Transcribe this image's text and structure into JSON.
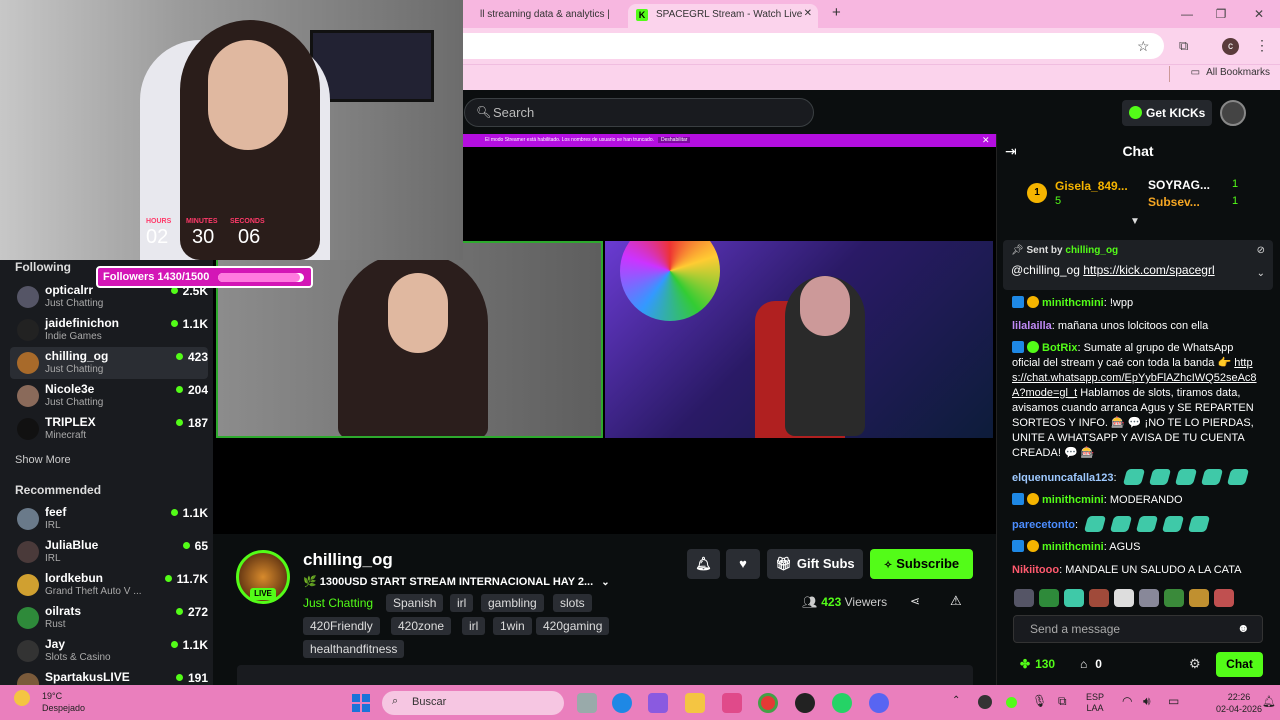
{
  "browser": {
    "tabs": [
      {
        "title": "ll streaming data & analytics |"
      },
      {
        "title": "SPACEGRL Stream - Watch Live"
      }
    ],
    "new_tab": "+",
    "profile_initial": "c",
    "bookmarks_label": "All Bookmarks"
  },
  "kick_header": {
    "search_placeholder": "Search",
    "get_kicks": "Get KICKs"
  },
  "overlay": {
    "timer_labels": [
      "HOURS",
      "MINUTES",
      "SECONDS"
    ],
    "timer_values": [
      "02",
      "30",
      "06"
    ],
    "followers_text": "Followers 1430/1500",
    "followers_progress": 0.953
  },
  "notice": {
    "text": "El modo Streamer está habilitado. Los nombres de usuario se han truncado.",
    "button": "Deshabilitar"
  },
  "sidebar": {
    "following_label": "Following",
    "following": [
      {
        "name": "opticalrr",
        "category": "Just Chatting",
        "viewers": "2.5K"
      },
      {
        "name": "jaidefinichon",
        "category": "Indie Games",
        "viewers": "1.1K"
      },
      {
        "name": "chilling_og",
        "category": "Just Chatting",
        "viewers": "423"
      },
      {
        "name": "Nicole3e",
        "category": "Just Chatting",
        "viewers": "204"
      },
      {
        "name": "TRIPLEX",
        "category": "Minecraft",
        "viewers": "187"
      }
    ],
    "show_more": "Show More",
    "recommended_label": "Recommended",
    "recommended": [
      {
        "name": "feef",
        "category": "IRL",
        "viewers": "1.1K"
      },
      {
        "name": "JuliaBlue",
        "category": "IRL",
        "viewers": "65"
      },
      {
        "name": "lordkebun",
        "category": "Grand Theft Auto V ...",
        "viewers": "11.7K"
      },
      {
        "name": "oilrats",
        "category": "Rust",
        "viewers": "272"
      },
      {
        "name": "Jay",
        "category": "Slots & Casino",
        "viewers": "1.1K"
      },
      {
        "name": "SpartakusLIVE",
        "category": "",
        "viewers": "191"
      }
    ]
  },
  "stream": {
    "channel": "chilling_og",
    "live_badge": "LIVE",
    "title": "🌿 1300USD START STREAM INTERNACIONAL HAY 2...",
    "category": "Just Chatting",
    "tags": [
      "Spanish",
      "irl",
      "gambling",
      "slots",
      "420Friendly",
      "420zone",
      "irl",
      "1win",
      "420gaming",
      "healthandfitness"
    ],
    "gift_subs": "Gift Subs",
    "subscribe": "Subscribe",
    "viewers_count": "423",
    "viewers_label": "Viewers"
  },
  "chat": {
    "title": "Chat",
    "gifters": [
      {
        "name": "Gisela_849...",
        "count": "5"
      },
      {
        "name": "SOYRAG...",
        "count": "1"
      },
      {
        "name": "Subsev...",
        "count": "1"
      }
    ],
    "pinned": {
      "sent_by": "Sent by",
      "sender": "chilling_og",
      "mention": "@chilling_og",
      "link": "https://kick.com/spacegrl"
    },
    "messages": [
      {
        "user": "minithcmini",
        "color": "#53fc18",
        "text": "!wpp",
        "badges": true
      },
      {
        "user": "lilalailla",
        "color": "#c08af5",
        "text": "mañana unos lolcitoos con ella",
        "badges": false
      },
      {
        "user": "BotRix",
        "color": "#53fc18",
        "text": "Sumate al grupo de WhatsApp oficial del stream y caé con toda la banda 👉",
        "link": "https://chat.whatsapp.com/EpYybFlAZhcIWQ52seAc8A?mode=gl_t",
        "text2": " Hablamos de slots, tiramos data, avisamos cuando arranca Agus y SE REPARTEN SORTEOS Y INFO. 🎰 💬 ¡NO TE LO PIERDAS, UNITE A WHATSAPP Y AVISA DE TU CUENTA CREADA! 💬 🎰",
        "badges": true
      },
      {
        "user": "elquenuncafalla123",
        "color": "#9ec9ff",
        "text": "",
        "emotes": 5,
        "badges": false
      },
      {
        "user": "minithcmini",
        "color": "#53fc18",
        "text": "MODERANDO",
        "badges": true
      },
      {
        "user": "parecetonto",
        "color": "#4c8dff",
        "text": "",
        "emotes": 5,
        "badges": false
      },
      {
        "user": "minithcmini",
        "color": "#53fc18",
        "text": "AGUS",
        "badges": true
      },
      {
        "user": "Nikiitooo",
        "color": "#ff5a6e",
        "text": "MANDALE UN SALUDO A LA CATA",
        "badges": false
      }
    ],
    "input_placeholder": "Send a message",
    "points": "130",
    "vault": "0",
    "send_button": "Chat"
  },
  "taskbar": {
    "weather_temp": "19°C",
    "weather_desc": "Despejado",
    "search": "Buscar",
    "lang": "ESP",
    "lang_sub": "LAA",
    "time": "22:26",
    "date": "02-04-2026"
  },
  "colors": {
    "kick_green": "#53fc18",
    "overlay_pink": "#d316b6"
  }
}
